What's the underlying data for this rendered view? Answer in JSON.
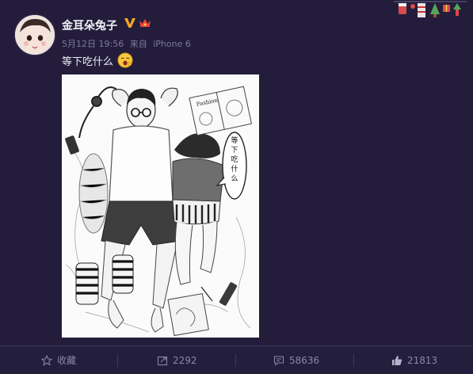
{
  "post": {
    "username": "金耳朵兔子",
    "date": "5月12日 19:56",
    "source_prefix": "来自",
    "source_device": "iPhone 6",
    "text": "等下吃什么",
    "image": {
      "speech_bubble": [
        "等",
        "下",
        "吃",
        "什",
        "么"
      ],
      "magazine_label": "Fashion"
    }
  },
  "footer": {
    "favorite_label": "收藏",
    "repost_count": "2292",
    "comment_count": "58636",
    "like_count": "21813"
  },
  "icons": {
    "verified": "v-badge-icon",
    "member": "crown-icon",
    "emoji": "yawn-emoji",
    "favorite": "star-icon",
    "repost": "repost-icon",
    "comment": "comment-icon",
    "like": "thumbs-up-icon"
  },
  "colors": {
    "background": "#231d3b",
    "verified": "#f5a623",
    "text_muted": "#7f7a98"
  }
}
